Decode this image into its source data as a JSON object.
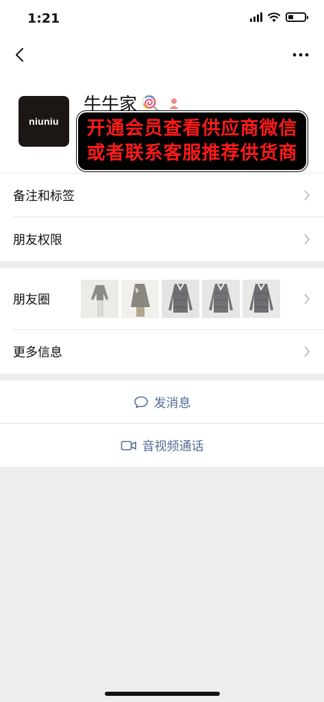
{
  "status_bar": {
    "time": "1:21",
    "battery_level": 0.3,
    "icons": [
      "signal-icon",
      "wifi-icon",
      "battery-icon"
    ]
  },
  "nav": {
    "back_icon": "back-chevron-icon",
    "more_icon": "more-dots-icon"
  },
  "profile": {
    "avatar_text": "niuniu",
    "name": "牛牛家",
    "name_emoji_icon": "lollipop-icon",
    "gender_icon": "person-badge-icon",
    "promo_line1": "开通会员查看供应商微信",
    "promo_line2": "或者联系客服推荐供货商",
    "promo_text_color": "#ff1a1a"
  },
  "settings": {
    "remark_tags": "备注和标签",
    "friend_permissions": "朋友权限"
  },
  "moments": {
    "label": "朋友圈",
    "thumbnails": [
      "jacket-photo",
      "jacket-photo",
      "jacket-photo",
      "jacket-photo",
      "jacket-photo"
    ]
  },
  "more_info": {
    "label": "更多信息"
  },
  "actions": {
    "send_message": "发消息",
    "video_call": "音视频通话",
    "link_color": "#576b95"
  }
}
